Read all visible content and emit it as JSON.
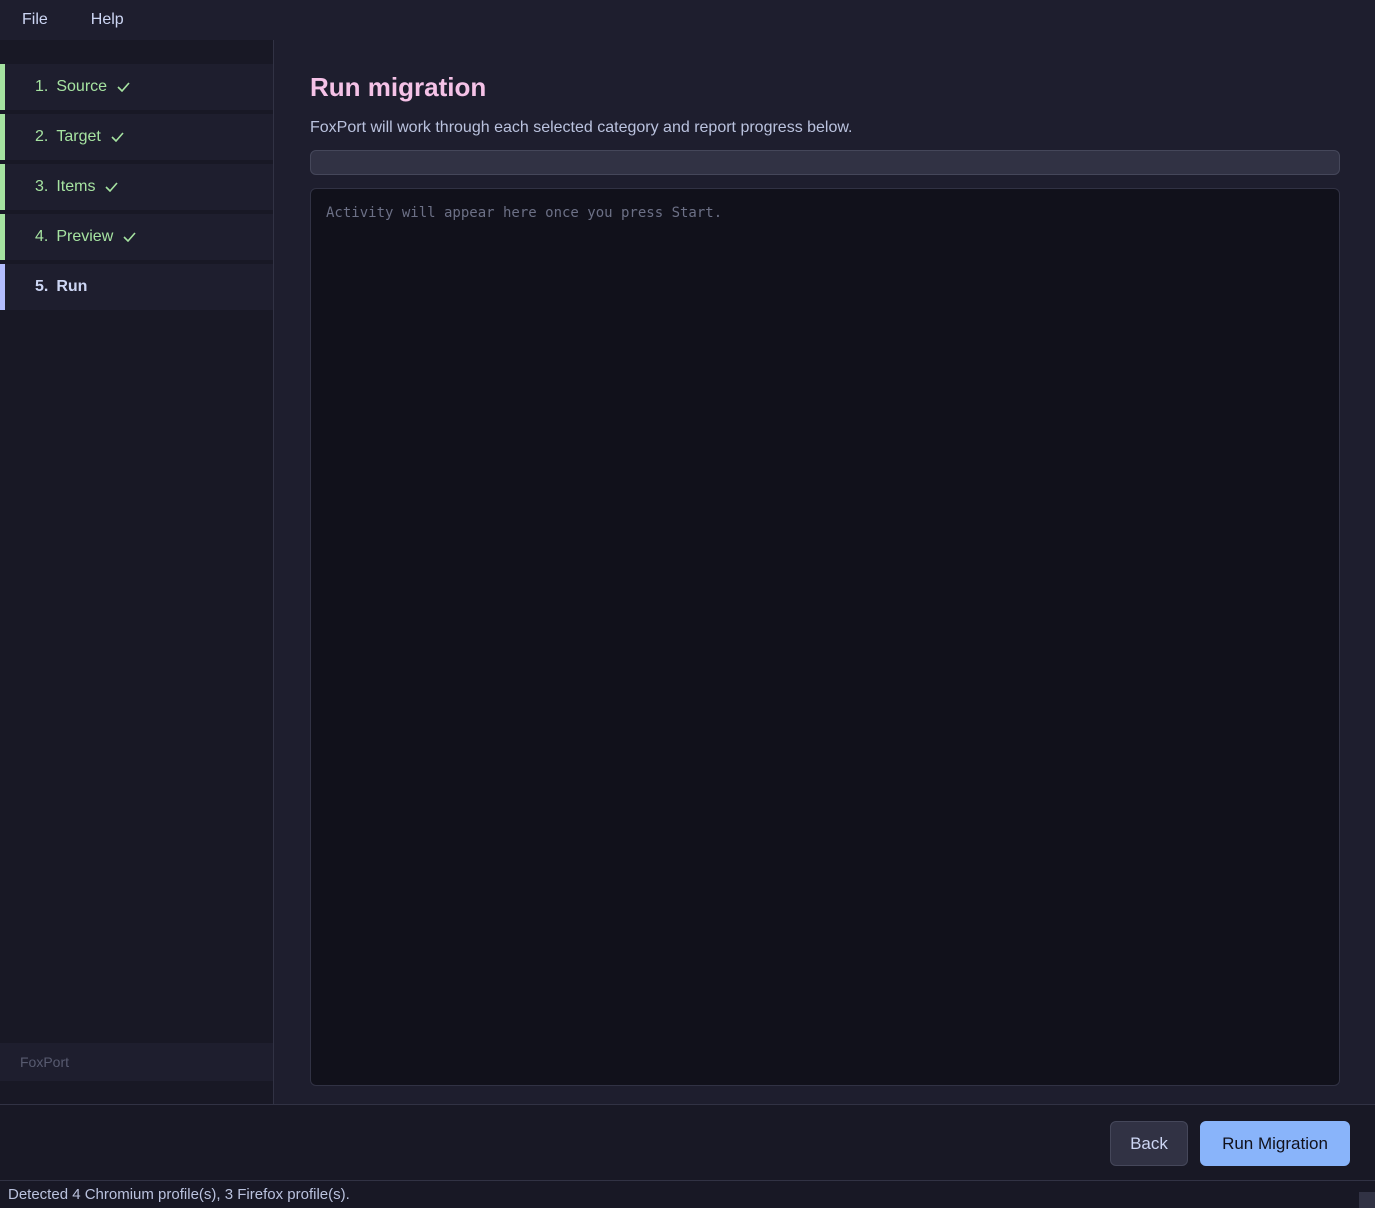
{
  "menu": {
    "file": "File",
    "help": "Help"
  },
  "sidebar": {
    "steps": [
      {
        "number": "1.",
        "label": "Source",
        "status": "complete"
      },
      {
        "number": "2.",
        "label": "Target",
        "status": "complete"
      },
      {
        "number": "3.",
        "label": "Items",
        "status": "complete"
      },
      {
        "number": "4.",
        "label": "Preview",
        "status": "complete"
      },
      {
        "number": "5.",
        "label": "Run",
        "status": "active"
      }
    ],
    "footer": "FoxPort"
  },
  "main": {
    "title": "Run migration",
    "subtitle": "FoxPort will work through each selected category and report progress below.",
    "progress_percent": 0,
    "log_placeholder": "Activity will appear here once you press Start."
  },
  "buttons": {
    "back": "Back",
    "run": "Run Migration"
  },
  "status": {
    "text": "Detected 4 Chromium profile(s), 3 Firefox profile(s)."
  },
  "colors": {
    "complete": "#a6e3a1",
    "active_accent": "#b4befe",
    "title": "#f5c2e7",
    "primary_button": "#89b4fa"
  }
}
